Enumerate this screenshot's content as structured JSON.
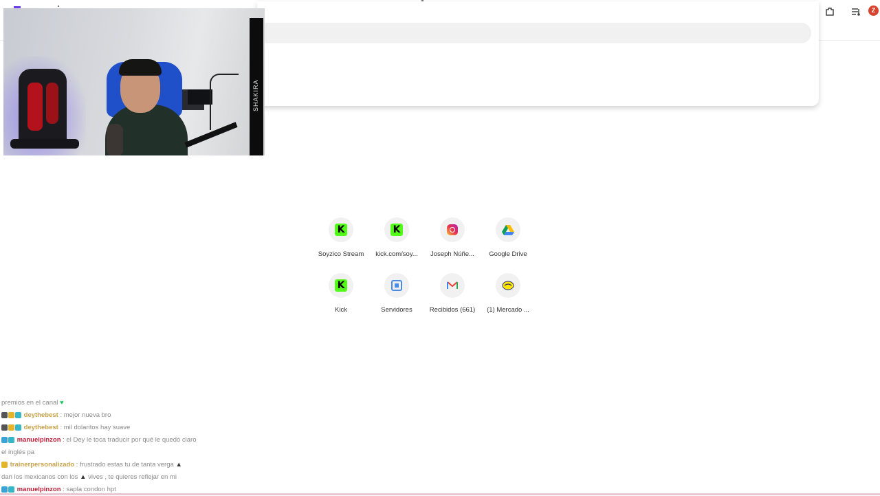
{
  "browser": {
    "profile_initial": "Z",
    "icons": [
      "extension-icon",
      "media-icon"
    ],
    "omnibox": {
      "value": "",
      "placeholder": ""
    }
  },
  "overlay": {
    "webcam_strap_text": "SHAKIRA"
  },
  "shortcuts": [
    {
      "label": "Soyzico Stream",
      "icon": "kick-icon"
    },
    {
      "label": "kick.com/soy...",
      "icon": "kick-icon"
    },
    {
      "label": "Joseph Núñe...",
      "icon": "instagram-icon"
    },
    {
      "label": "Google Drive",
      "icon": "google-drive-icon"
    },
    {
      "label": "Kick",
      "icon": "kick-icon"
    },
    {
      "label": "Servidores",
      "icon": "servers-icon"
    },
    {
      "label": "Recibidos (661)",
      "icon": "gmail-icon"
    },
    {
      "label": "(1) Mercado ...",
      "icon": "mercado-libre-icon"
    }
  ],
  "chat": {
    "messages": [
      {
        "user": "",
        "text": "premios en el canal"
      },
      {
        "user": "deythebest",
        "text": ": mejor nueva bro"
      },
      {
        "user": "deythebest",
        "text": ": mil dolaritos hay suave"
      },
      {
        "user": "manuelpinzon",
        "text": ": el Dey le toca traducir por qué le quedó claro"
      },
      {
        "user": "",
        "text": "el inglés pa"
      },
      {
        "user": "trainerpersonalizado",
        "text": ": frustrado estas tu de tanta verga"
      },
      {
        "user": "",
        "text": "dan los mexicanos con los"
      },
      {
        "user": "",
        "text": "vives , te quieres reflejar en mi"
      },
      {
        "user": "manuelpinzon",
        "text": ": sapla condon hpt"
      }
    ]
  },
  "colors": {
    "kick_green": "#53fc18",
    "profile_red": "#d9442f"
  }
}
